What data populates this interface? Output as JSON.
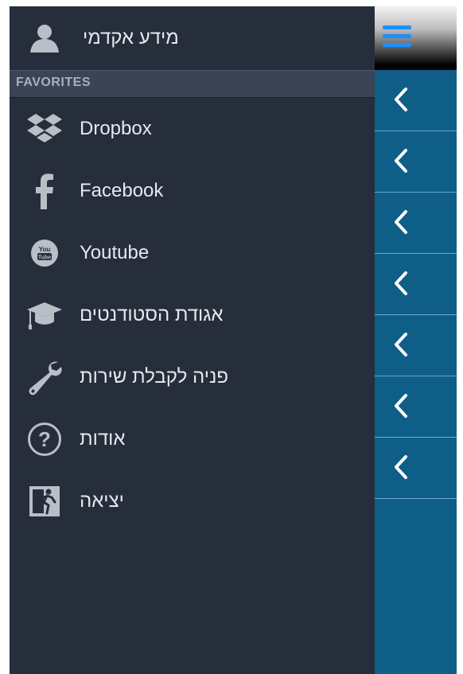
{
  "header": {
    "profile_label": "מידע אקדמי",
    "profile_icon": "user-icon"
  },
  "section": {
    "title": "FAVORITES"
  },
  "menu": {
    "items": [
      {
        "label": "Dropbox",
        "icon": "dropbox-icon"
      },
      {
        "label": "Facebook",
        "icon": "facebook-icon"
      },
      {
        "label": "Youtube",
        "icon": "youtube-icon"
      },
      {
        "label": "אגודת הסטודנטים",
        "icon": "graduation-cap-icon"
      },
      {
        "label": "פניה לקבלת שירות",
        "icon": "wrench-icon"
      },
      {
        "label": "אודות",
        "icon": "question-icon"
      },
      {
        "label": "יציאה",
        "icon": "exit-icon"
      }
    ]
  },
  "panel": {
    "hamburger_icon": "hamburger-icon",
    "row_icon": "chevron-left-icon",
    "row_count": 7
  },
  "colors": {
    "menu_bg": "#262d3b",
    "section_bg": "#3a4455",
    "panel_bg": "#0e5e87",
    "hamburger": "#1c8fff",
    "text": "#e6e9ee"
  }
}
